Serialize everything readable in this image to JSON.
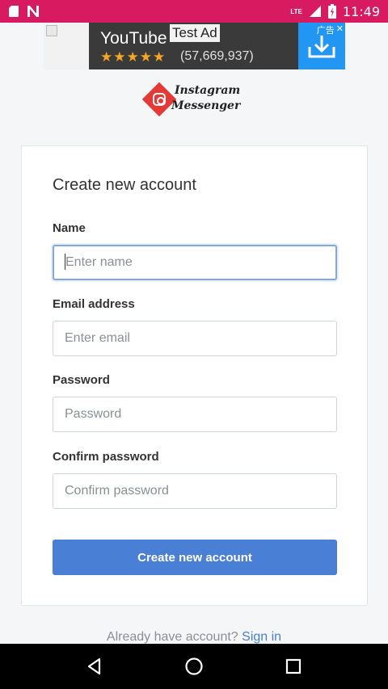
{
  "status_bar": {
    "time": "11:49",
    "network": "LTE",
    "background": "#d81b60"
  },
  "ad": {
    "title": "YouTube",
    "label": "Test Ad",
    "stars": "★★★★★",
    "rating_count": "(57,669,937)",
    "tag": "广告",
    "cta_icon": "download-icon",
    "cta_color": "#2196f3"
  },
  "logo": {
    "line1": "Instagram",
    "line2": "Messenger",
    "icon": "instagram-icon",
    "color": "#e53935"
  },
  "form": {
    "title": "Create new account",
    "name": {
      "label": "Name",
      "placeholder": "Enter name",
      "value": ""
    },
    "email": {
      "label": "Email address",
      "placeholder": "Enter email",
      "value": ""
    },
    "password": {
      "label": "Password",
      "placeholder": "Password",
      "value": ""
    },
    "confirm": {
      "label": "Confirm password",
      "placeholder": "Confirm password",
      "value": ""
    },
    "submit_label": "Create new account",
    "accent": "#4a7fd6"
  },
  "footer": {
    "prompt": "Already have account?",
    "link": "Sign in"
  },
  "nav": {
    "back": "back-icon",
    "home": "home-icon",
    "recents": "recents-icon"
  }
}
